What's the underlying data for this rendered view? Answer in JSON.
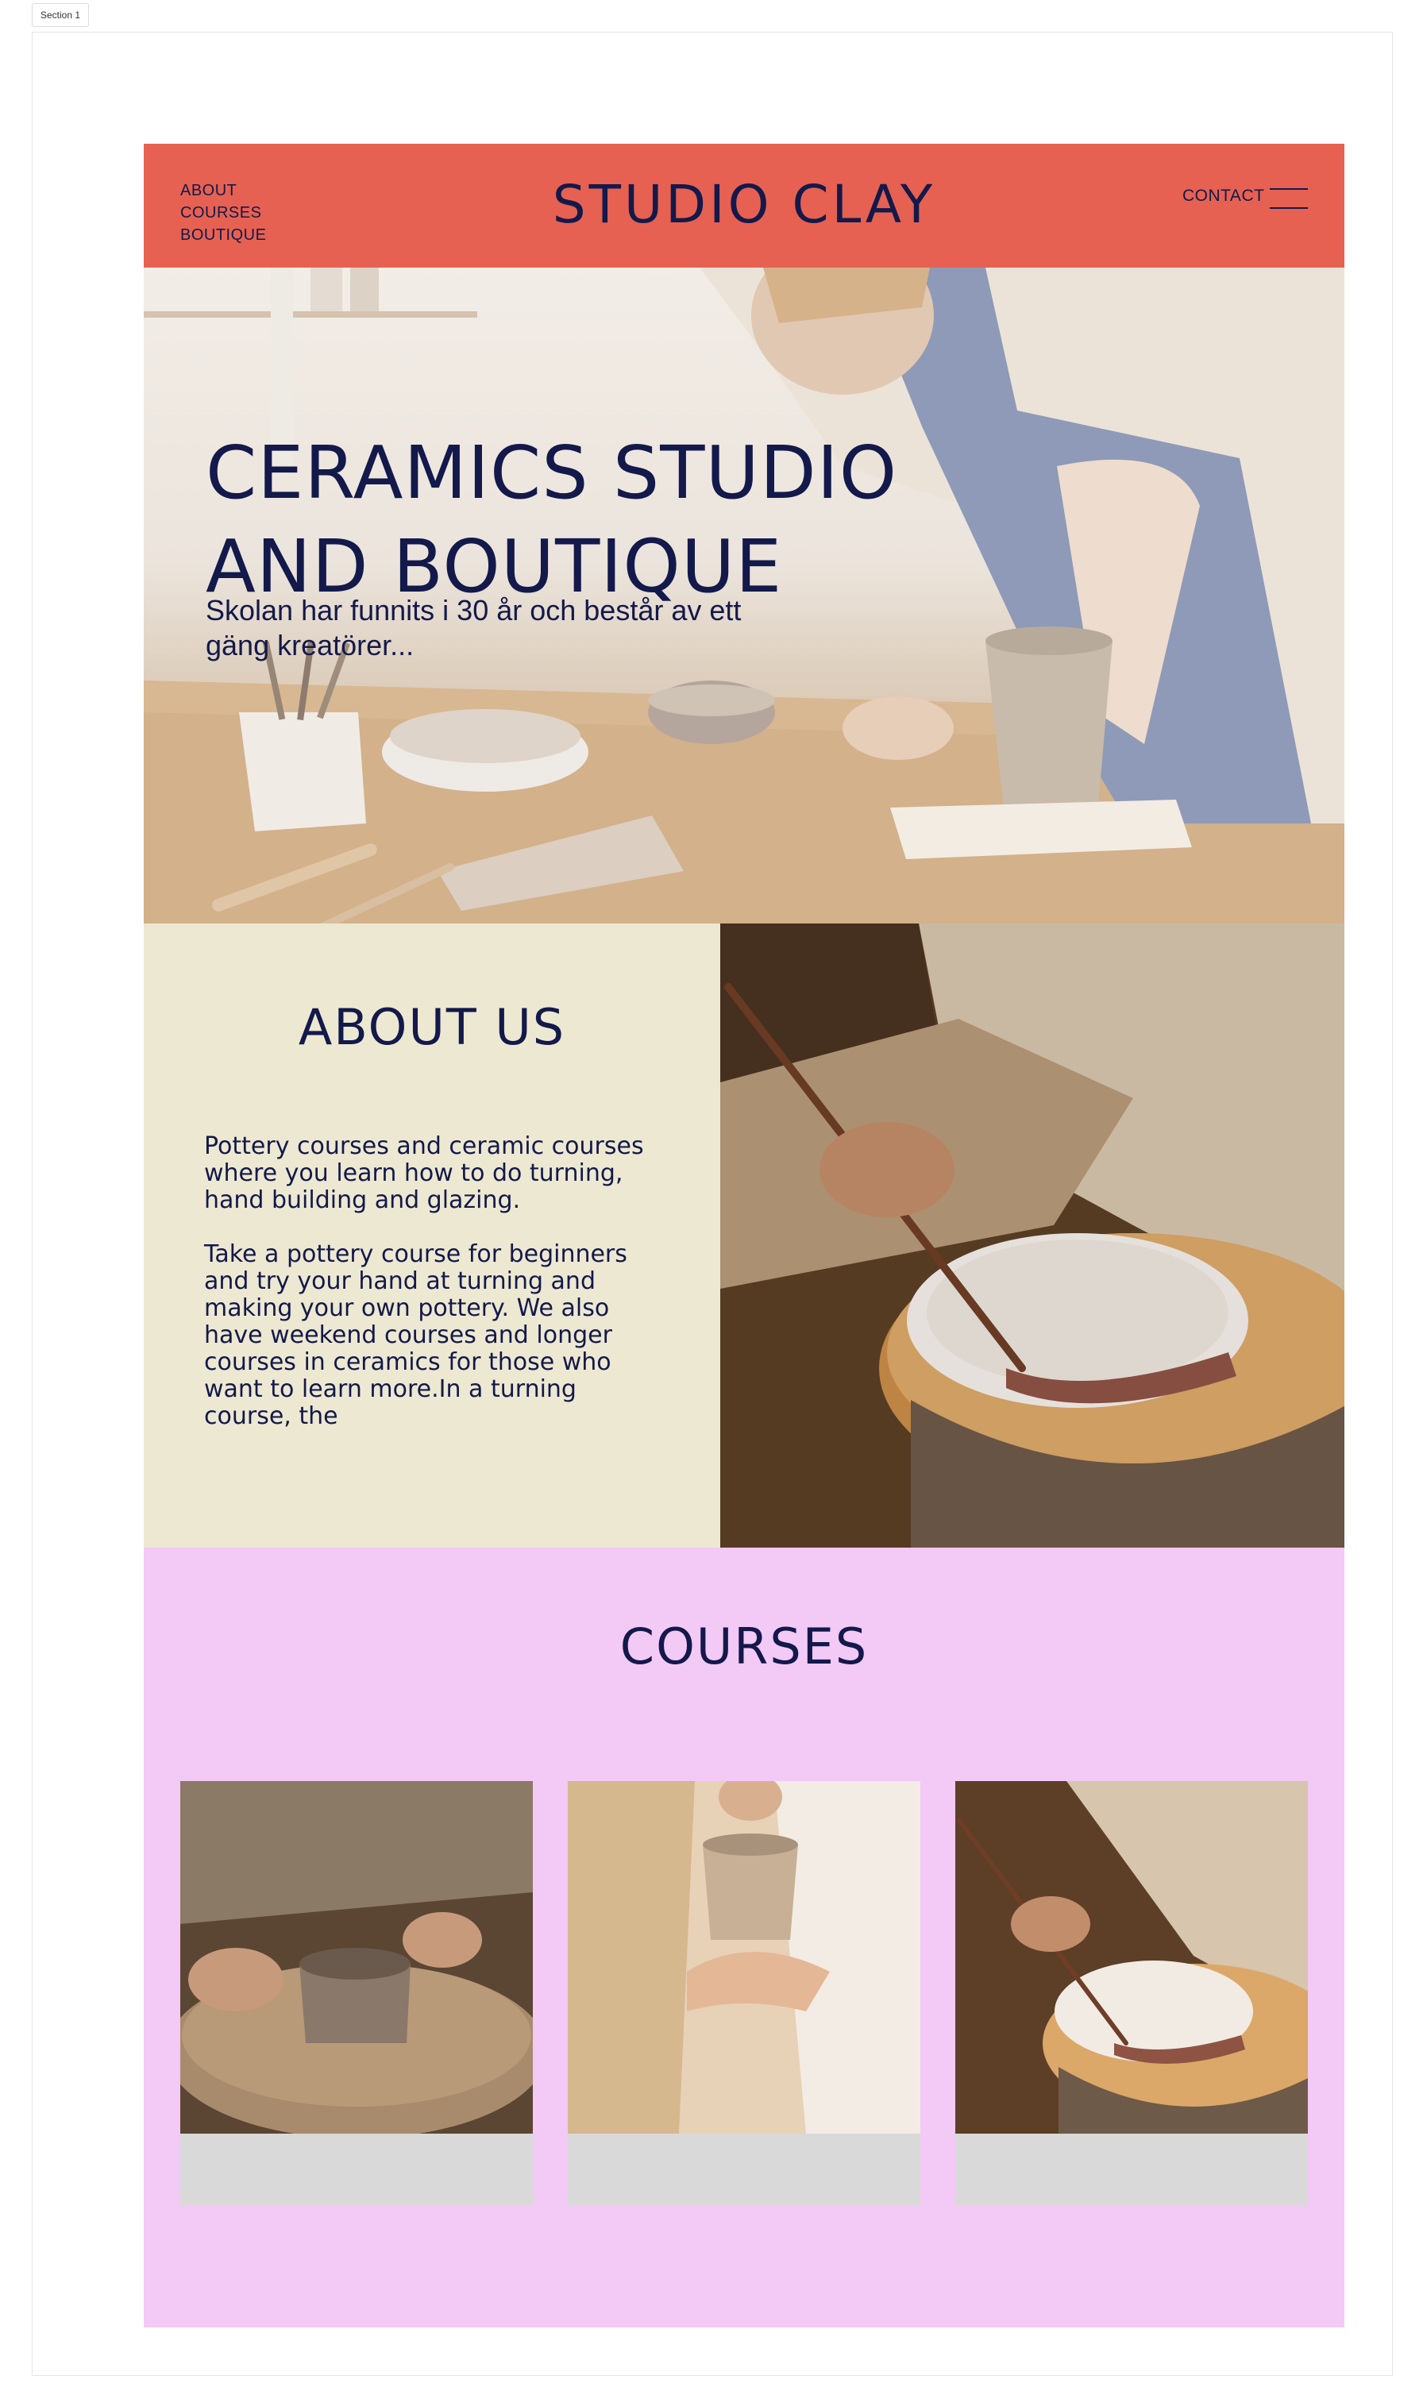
{
  "section_label": "Section 1",
  "header": {
    "nav": [
      "ABOUT",
      "COURSES",
      "BOUTIQUE"
    ],
    "brand": "STUDIO CLAY",
    "contact": "CONTACT"
  },
  "hero": {
    "title": "CERAMICS STUDIO AND BOUTIQUE",
    "subtitle": "Skolan har funnits i 30 år och består av ett gäng kreatörer..."
  },
  "about": {
    "title": "ABOUT US",
    "paragraph_1": "Pottery courses and ceramic courses where you learn how to do turning, hand building and glazing.",
    "paragraph_2": "Take a pottery course for beginners and try your hand at turning and making your own pottery. We also have weekend courses and longer courses in ceramics for those who want to learn more.In a turning course, the"
  },
  "courses": {
    "title": "COURSES"
  },
  "colors": {
    "header": "#e66152",
    "navy": "#13194a",
    "about_bg": "#ede8d1",
    "courses_bg": "#f3c9f6",
    "card_bg": "#d9d9d9"
  }
}
